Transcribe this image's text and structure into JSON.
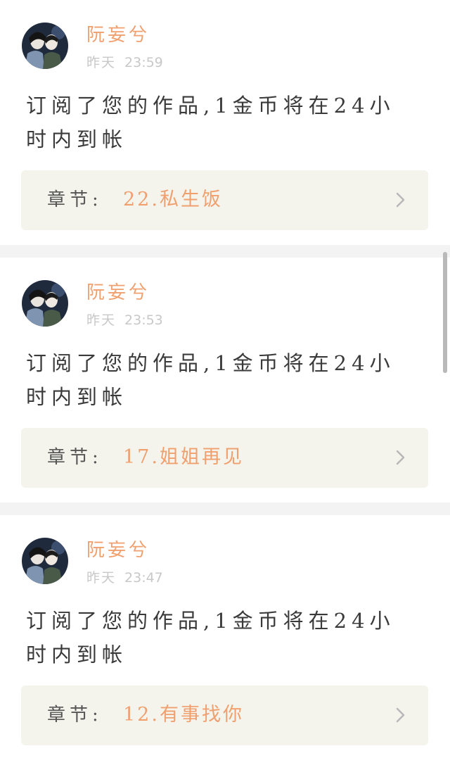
{
  "notifications": [
    {
      "user": "阮妄兮",
      "date": "昨天",
      "time": "23:59",
      "message": "订阅了您的作品,1金币将在24小时内到帐",
      "chapter_label": "章节:",
      "chapter_title": "22.私生饭"
    },
    {
      "user": "阮妄兮",
      "date": "昨天",
      "time": "23:53",
      "message": "订阅了您的作品,1金币将在24小时内到帐",
      "chapter_label": "章节:",
      "chapter_title": "17.姐姐再见"
    },
    {
      "user": "阮妄兮",
      "date": "昨天",
      "time": "23:47",
      "message": "订阅了您的作品,1金币将在24小时内到帐",
      "chapter_label": "章节:",
      "chapter_title": "12.有事找你"
    }
  ],
  "colors": {
    "accent": "#f0a06e",
    "chapter_bg": "#f4f4ed",
    "separator": "#f3f3f3",
    "meta_text": "#c8c8c8"
  },
  "icons": {
    "chevron": "chevron-right-icon",
    "avatar": "avatar-image"
  }
}
